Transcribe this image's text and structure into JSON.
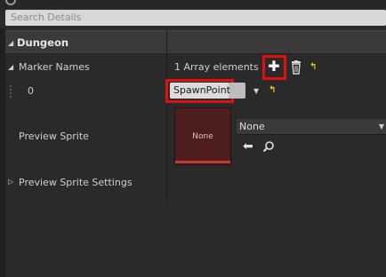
{
  "search": {
    "placeholder": "Search Details"
  },
  "category": {
    "label": "Dungeon"
  },
  "marker_names": {
    "label": "Marker Names",
    "array_count": "1 Array elements",
    "element_index": "0",
    "element_value": "SpawnPoint"
  },
  "preview_sprite": {
    "label": "Preview Sprite",
    "thumbnail_text": "None",
    "asset_value": "None"
  },
  "preview_sprite_settings": {
    "label": "Preview Sprite Settings"
  },
  "colors": {
    "highlight": "#e01010",
    "reset_arrow": "#e6d100",
    "thumbnail_bg": "#4e1d1d",
    "thumbnail_bar": "#c23b3b"
  }
}
